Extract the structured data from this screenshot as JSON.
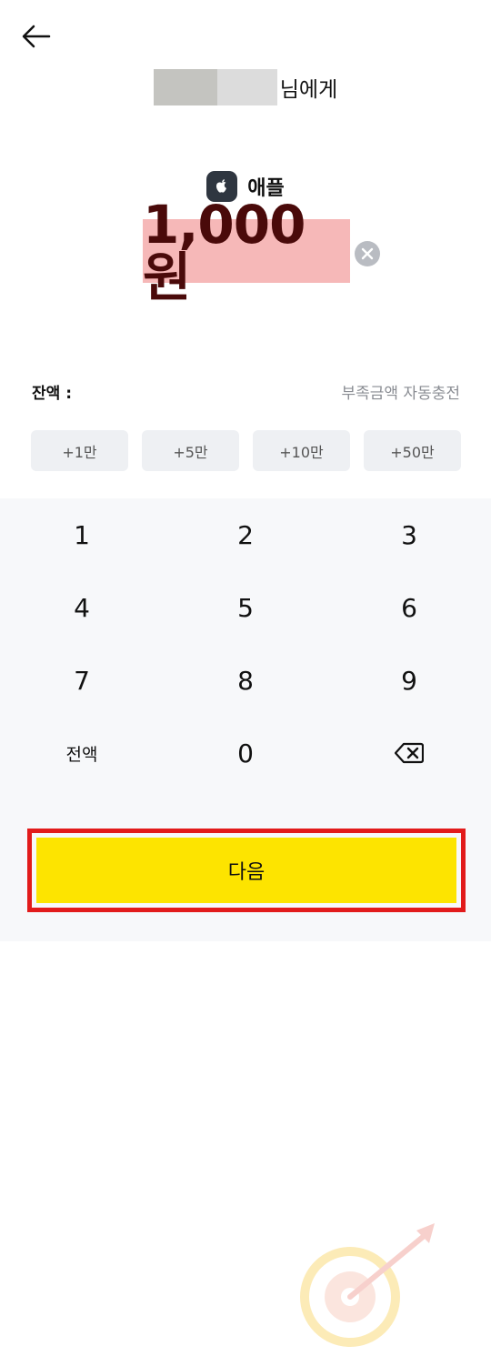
{
  "header": {
    "back_icon": "arrow-left-icon"
  },
  "recipient": {
    "suffix": "님에게"
  },
  "merchant": {
    "icon": "apple-logo-icon",
    "name": "애플"
  },
  "amount": {
    "value": "1,000원",
    "clear_icon": "clear-icon"
  },
  "balance": {
    "label": "잔액 :"
  },
  "auto_charge": {
    "label": "부족금액 자동충전"
  },
  "quick_amounts": [
    "+1만",
    "+5만",
    "+10만",
    "+50만"
  ],
  "keypad": {
    "keys": [
      "1",
      "2",
      "3",
      "4",
      "5",
      "6",
      "7",
      "8",
      "9",
      "전액",
      "0"
    ],
    "backspace_icon": "backspace-icon"
  },
  "next_button": {
    "label": "다음"
  },
  "colors": {
    "accent_yellow": "#fde400",
    "highlight_red": "#e21b1b",
    "amount_highlight": "#f6b8b8",
    "amount_text": "#4a0a0a"
  }
}
